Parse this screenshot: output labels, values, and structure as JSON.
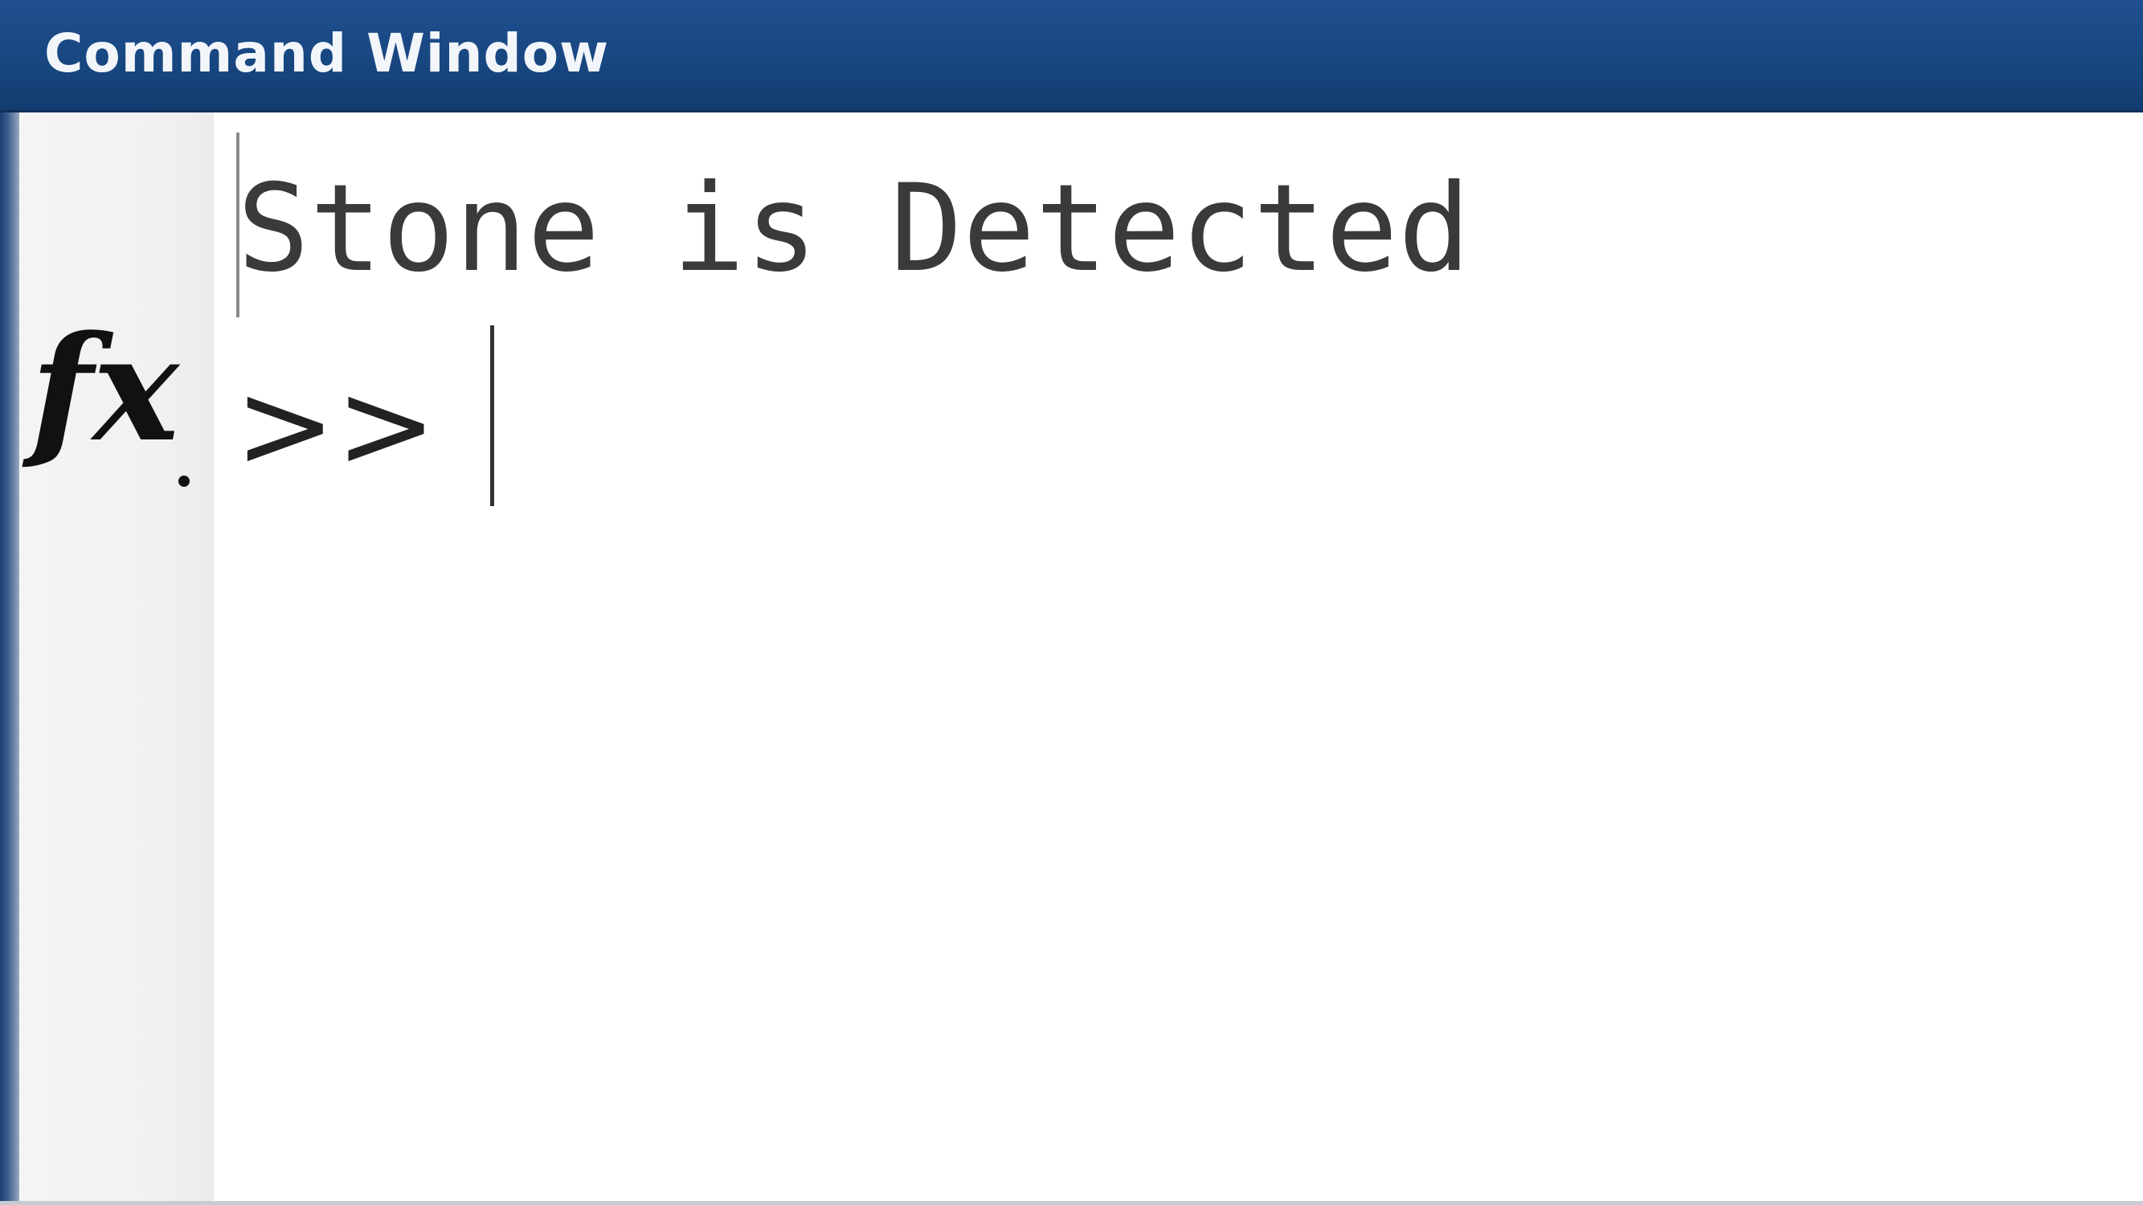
{
  "window": {
    "title": "Command Window"
  },
  "console": {
    "output_lines": [
      "Stone is Detected"
    ],
    "prompt": ">>",
    "input_value": ""
  },
  "icons": {
    "function_browser": "fx-icon"
  }
}
